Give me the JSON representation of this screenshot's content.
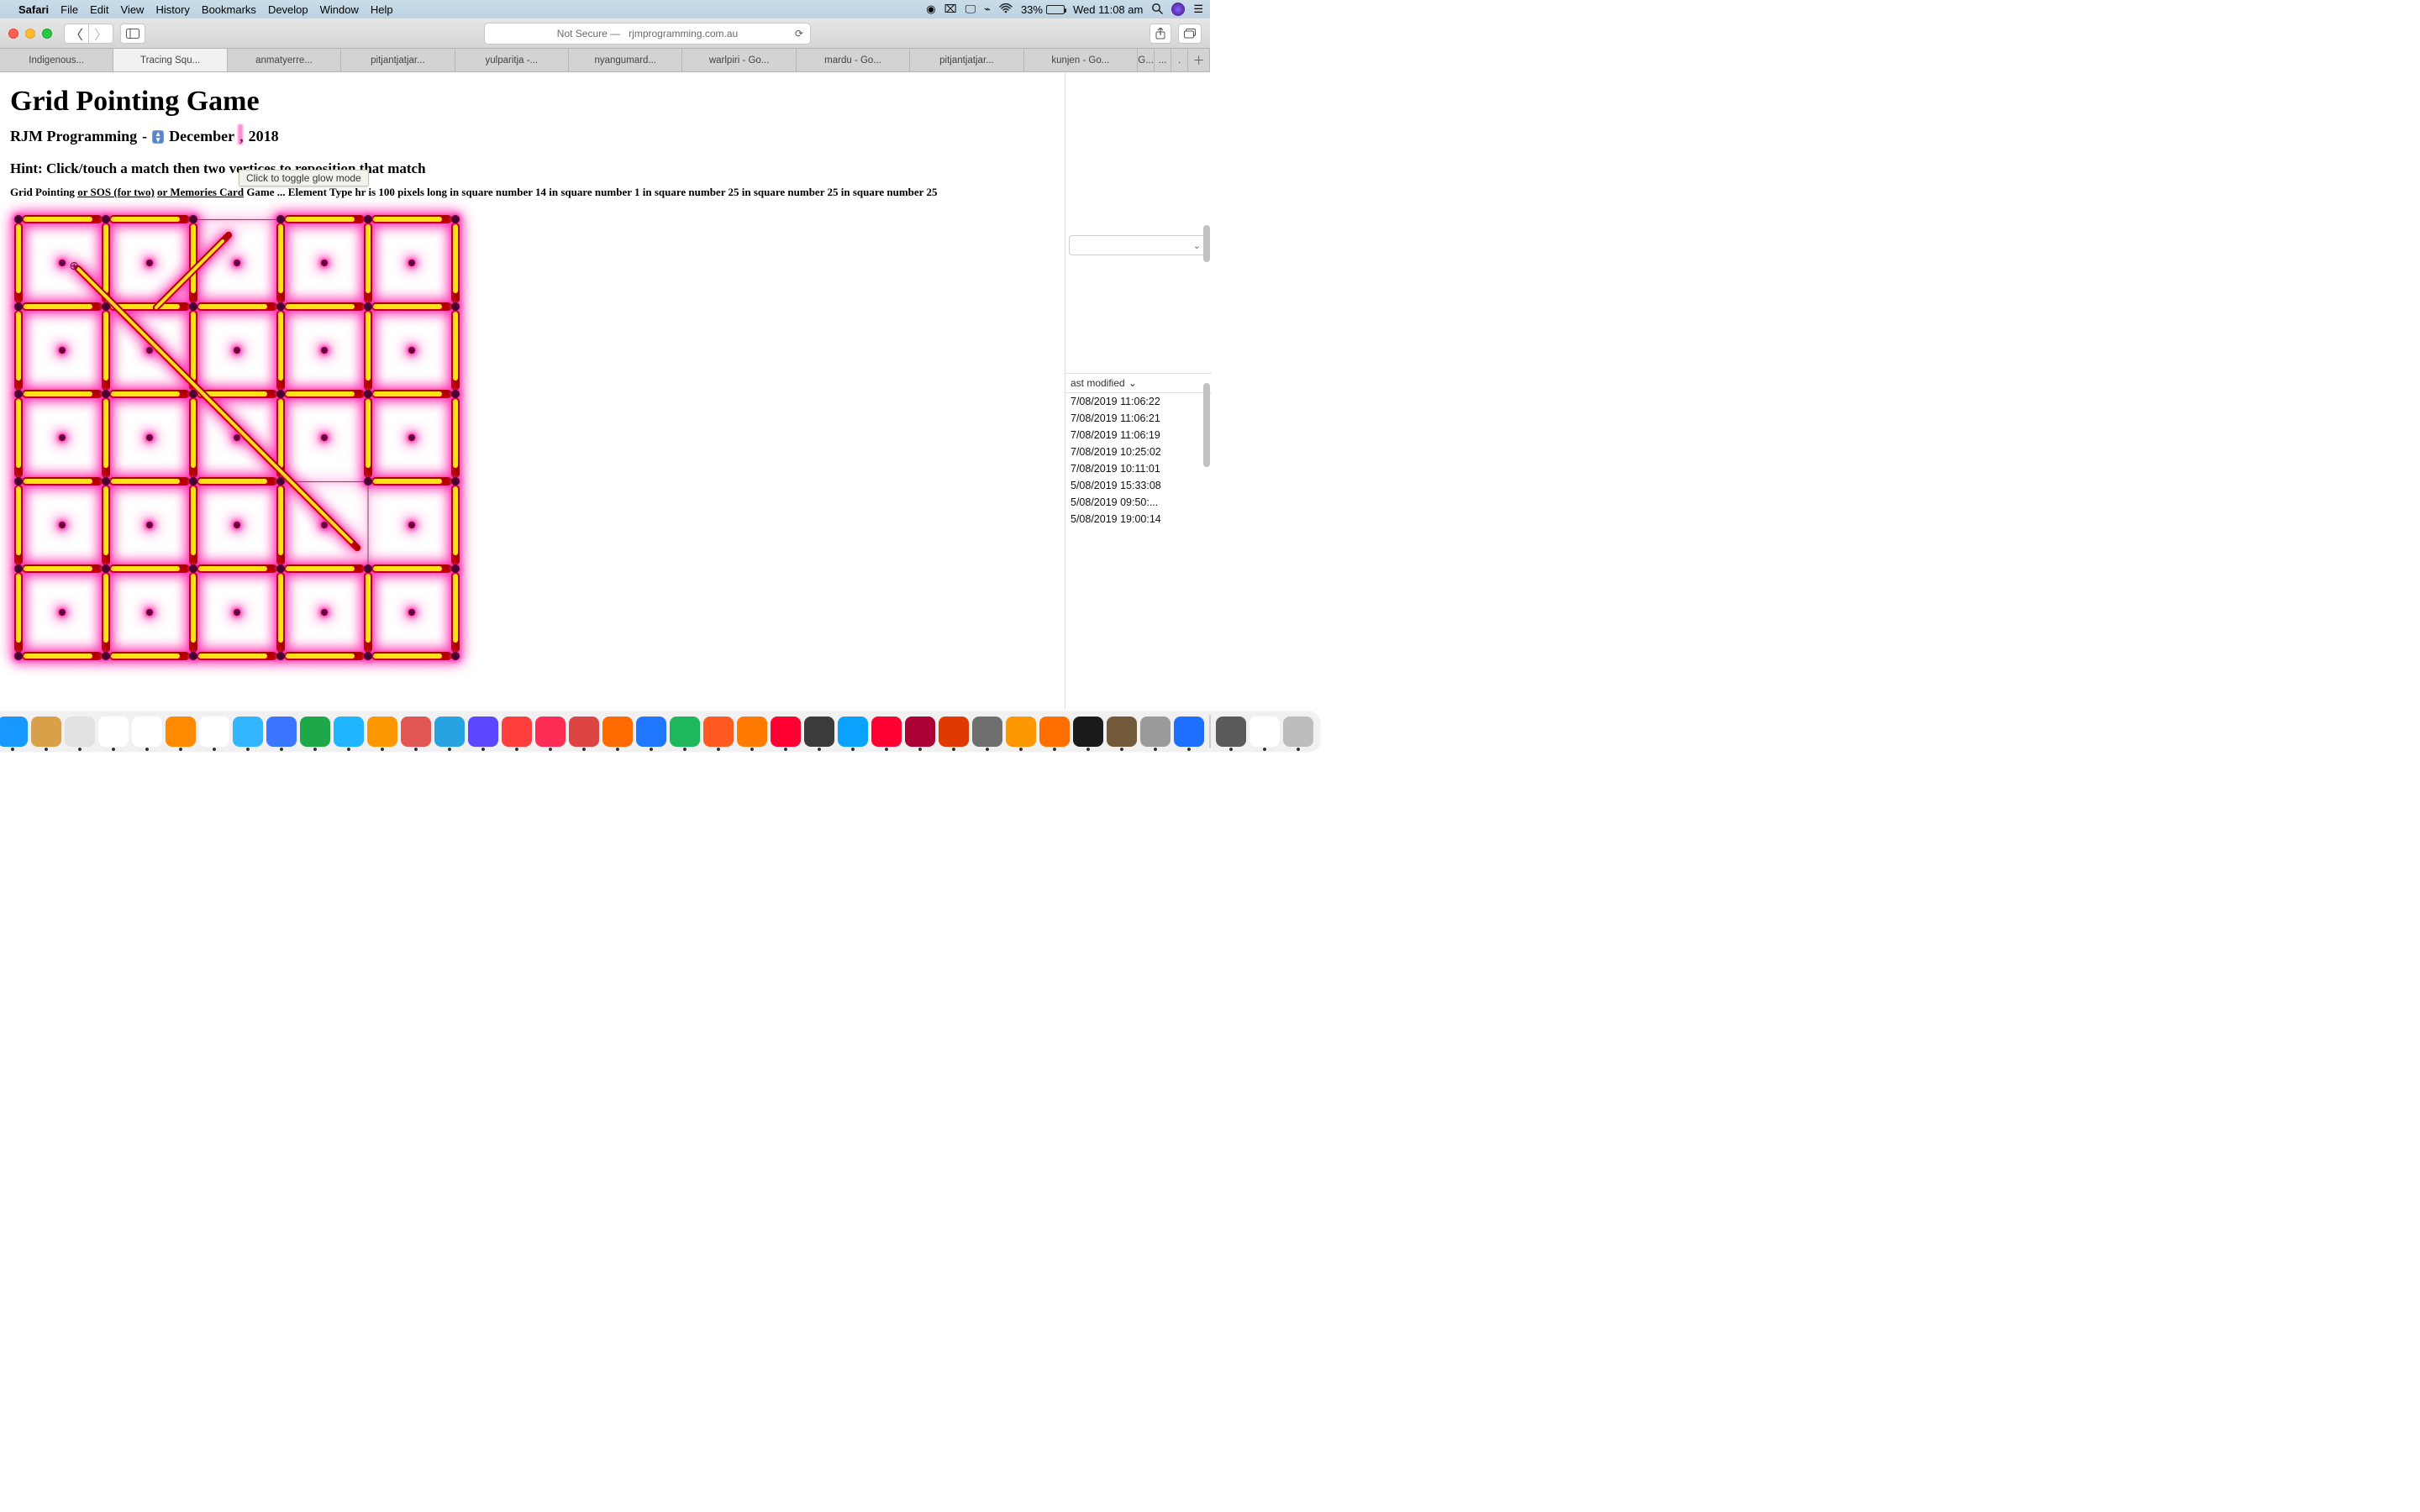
{
  "menubar": {
    "app": "Safari",
    "items": [
      "File",
      "Edit",
      "View",
      "History",
      "Bookmarks",
      "Develop",
      "Window",
      "Help"
    ],
    "battery_pct": "33%",
    "clock": "Wed 11:08 am"
  },
  "toolbar": {
    "address_prefix": "Not Secure —",
    "address_host": "rjmprogramming.com.au"
  },
  "tabs": [
    "Indigenous...",
    "Tracing Squ...",
    "anmatyerre...",
    "pitjantjatjar...",
    "yulparitja -...",
    "nyangumard...",
    "warlpiri - Go...",
    "mardu - Go...",
    "pitjantjatjar...",
    "kunjen - Go...",
    "G..."
  ],
  "page": {
    "title": "Grid Pointing Game",
    "sub_left": "RJM Programming",
    "sub_dash": "-",
    "sub_month": "December",
    "sub_sep": ",",
    "sub_year": "2018",
    "hint": "Hint: Click/touch a match then two vertices to reposition that match",
    "tooltip": "Click to toggle glow mode",
    "mode_prefix": "Grid Pointing ",
    "mode_link1": "or SOS (for two)",
    "mode_link2": "or Memories Card",
    "mode_rest": " Game ... Element Type hr is 100 pixels long in square number 14 in square number 1 in square number 25 in square number 25 in square number 25"
  },
  "finder": {
    "header": "ast modified",
    "rows": [
      "7/08/2019 11:06:22",
      "7/08/2019 11:06:21",
      "7/08/2019 11:06:19",
      "7/08/2019 10:25:02",
      "7/08/2019 10:11:01",
      "5/08/2019 15:33:08",
      "5/08/2019 09:50:...",
      "5/08/2019 19:00:14"
    ]
  },
  "dock_count": 42
}
